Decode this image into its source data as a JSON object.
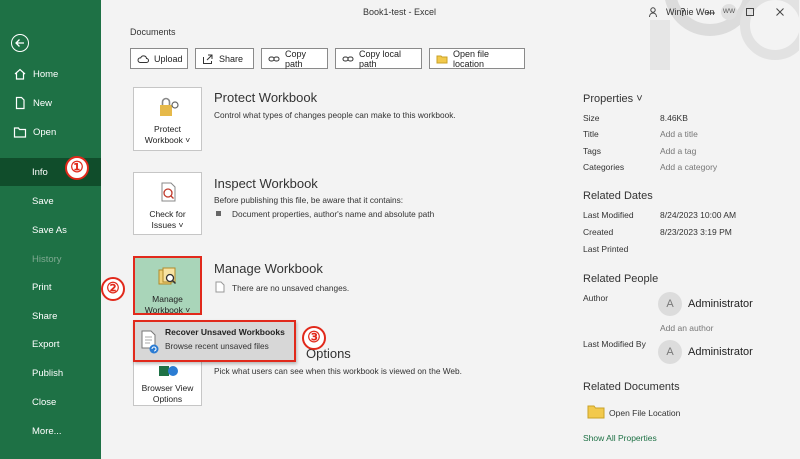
{
  "window": {
    "title": "Book1-test  -  Excel",
    "user_name": "Winnie Wen",
    "user_initials": "WW"
  },
  "sidebar": {
    "items": [
      {
        "label": "Home",
        "icon": "home-icon"
      },
      {
        "label": "New",
        "icon": "new-document-icon"
      },
      {
        "label": "Open",
        "icon": "open-folder-icon"
      },
      {
        "label": "Info"
      },
      {
        "label": "Save"
      },
      {
        "label": "Save As"
      },
      {
        "label": "History"
      },
      {
        "label": "Print"
      },
      {
        "label": "Share"
      },
      {
        "label": "Export"
      },
      {
        "label": "Publish"
      },
      {
        "label": "Close"
      },
      {
        "label": "More..."
      }
    ]
  },
  "documents": {
    "label": "Documents",
    "buttons": [
      {
        "label": "Upload",
        "icon": "cloud-upload-icon"
      },
      {
        "label": "Share",
        "icon": "share-icon"
      },
      {
        "label": "Copy path",
        "icon": "link-icon"
      },
      {
        "label": "Copy local path",
        "icon": "link-icon"
      },
      {
        "label": "Open file location",
        "icon": "folder-icon"
      }
    ]
  },
  "sections": {
    "protect": {
      "card_line1": "Protect",
      "card_line2": "Workbook ˅",
      "title": "Protect Workbook",
      "desc": "Control what types of changes people can make to this workbook."
    },
    "inspect": {
      "card_line1": "Check for",
      "card_line2": "Issues ˅",
      "title": "Inspect Workbook",
      "desc": "Before publishing this file, be aware that it contains:",
      "bullet": "Document properties, author's name and absolute path"
    },
    "manage": {
      "card_line1": "Manage",
      "card_line2": "Workbook ˅",
      "title": "Manage Workbook",
      "desc": "There are no unsaved changes."
    },
    "browser": {
      "card_line1": "Browser View",
      "card_line2": "Options",
      "title_visible": "Options",
      "desc": "Pick what users can see when this workbook is viewed on the Web."
    }
  },
  "dropdown": {
    "title": "Recover Unsaved Workbooks",
    "subtitle": "Browse recent unsaved files"
  },
  "badges": [
    "①",
    "②",
    "③"
  ],
  "properties": {
    "header": "Properties ˅",
    "rows": [
      {
        "key": "Size",
        "value": "8.46KB"
      },
      {
        "key": "Title",
        "value": "Add a title"
      },
      {
        "key": "Tags",
        "value": "Add a tag"
      },
      {
        "key": "Categories",
        "value": "Add a category"
      }
    ],
    "dates_header": "Related Dates",
    "dates": [
      {
        "key": "Last Modified",
        "value": "8/24/2023 10:00 AM"
      },
      {
        "key": "Created",
        "value": "8/23/2023 3:19 PM"
      },
      {
        "key": "Last Printed",
        "value": ""
      }
    ],
    "people_header": "Related People",
    "author_label": "Author",
    "author_initial": "A",
    "author_name": "Administrator",
    "add_author": "Add an author",
    "last_modified_by_label": "Last Modified By",
    "modifier_initial": "A",
    "modifier_name": "Administrator",
    "docs_header": "Related Documents",
    "open_file_location": "Open File Location",
    "show_all": "Show All Properties"
  },
  "colors": {
    "sidebar": "#1e7145",
    "sidebar_selected": "#104d2b",
    "highlight_red": "#e1291b",
    "manage_card": "#a9d5b9"
  }
}
